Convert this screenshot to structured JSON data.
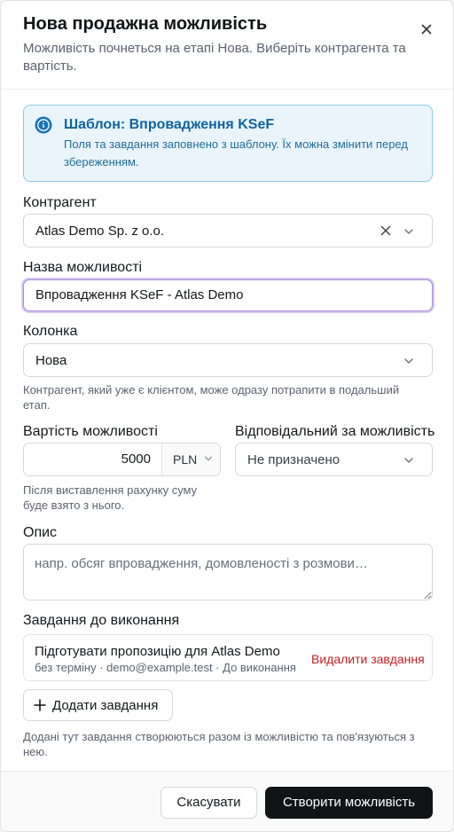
{
  "dialog": {
    "title": "Нова продажна можливість",
    "subtitle": "Можливість почнеться на етапі Нова. Виберіть контрагента та вартість.",
    "close_icon": "close-icon"
  },
  "notice": {
    "icon": "info-icon",
    "title": "Шаблон: Впровадження KSeF",
    "text": "Поля та завдання заповнено з шаблону. Їх можна змінити перед збереженням.",
    "accent_color": "#1163a0"
  },
  "contractor": {
    "label": "Контрагент",
    "value": "Atlas Demo Sp. z o.o."
  },
  "opportunity_name": {
    "label": "Назва можливості",
    "value": "Впровадження KSeF - Atlas Demo"
  },
  "column": {
    "label": "Колонка",
    "value": "Нова",
    "hint": "Контрагент, який уже є клієнтом, може одразу потрапити в подальший етап."
  },
  "value_field": {
    "label": "Вартість можливості",
    "amount": "5000",
    "currency": "PLN",
    "hint": "Після виставлення рахунку суму буде взято з нього."
  },
  "owner": {
    "label": "Відповідальний за можливість",
    "value": "Не призначено"
  },
  "description": {
    "label": "Опис",
    "placeholder": "напр. обсяг впровадження, домовленості з розмови…"
  },
  "tasks": {
    "label": "Завдання до виконання",
    "items": [
      {
        "title": "Підготувати пропозицію для Atlas Demo",
        "meta": "без терміну · demo@example.test · До виконання",
        "delete_label": "Видалити завдання"
      }
    ],
    "add_label": "Додати завдання",
    "hint": "Додані тут завдання створюються разом із можливістю та пов'язуються з нею."
  },
  "footer": {
    "cancel_label": "Скасувати",
    "create_label": "Створити можливість"
  },
  "colors": {
    "primary_button": "#121317",
    "danger": "#c51f24",
    "focus_ring": "#a78bd8"
  }
}
